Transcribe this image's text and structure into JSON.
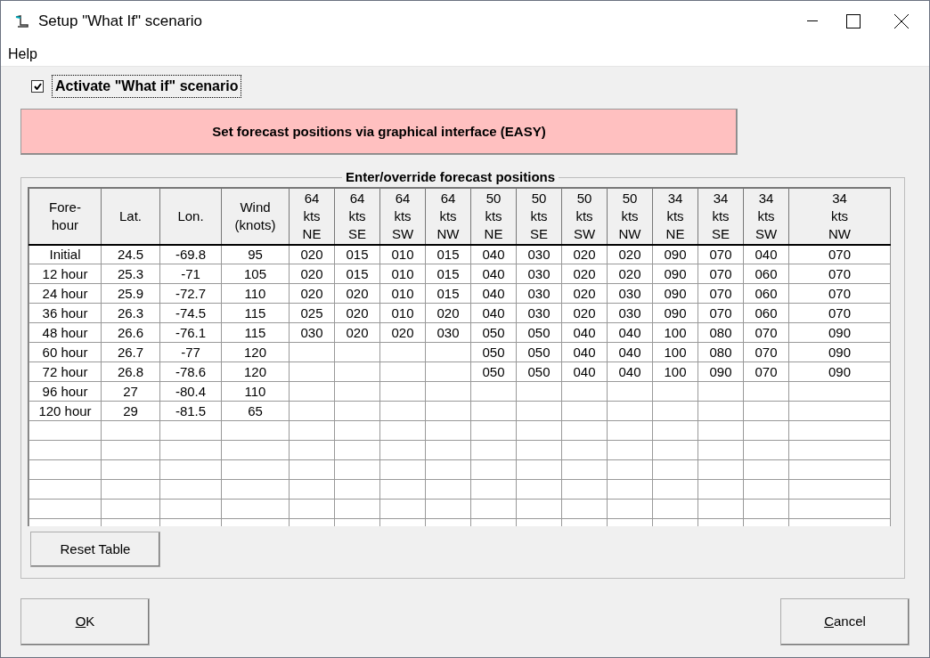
{
  "window": {
    "title": "Setup \"What If\" scenario"
  },
  "menu": [
    "Help"
  ],
  "activate": {
    "label": "Activate \"What if\" scenario",
    "checked": true
  },
  "graphical_button": "Set forecast positions via graphical interface (EASY)",
  "group": {
    "title": "Enter/override forecast positions",
    "columns": [
      "Fore-\nhour",
      "Lat.",
      "Lon.",
      "Wind\n(knots)",
      "64\nkts\nNE",
      "64\nkts\nSE",
      "64\nkts\nSW",
      "64\nkts\nNW",
      "50\nkts\nNE",
      "50\nkts\nSE",
      "50\nkts\nSW",
      "50\nkts\nNW",
      "34\nkts\nNE",
      "34\nkts\nSE",
      "34\nkts\nSW",
      "34\nkts\nNW"
    ],
    "rows": [
      [
        "Initial",
        "24.5",
        "-69.8",
        "95",
        "020",
        "015",
        "010",
        "015",
        "040",
        "030",
        "020",
        "020",
        "090",
        "070",
        "040",
        "070"
      ],
      [
        "12 hour",
        "25.3",
        "-71",
        "105",
        "020",
        "015",
        "010",
        "015",
        "040",
        "030",
        "020",
        "020",
        "090",
        "070",
        "060",
        "070"
      ],
      [
        "24 hour",
        "25.9",
        "-72.7",
        "110",
        "020",
        "020",
        "010",
        "015",
        "040",
        "030",
        "020",
        "030",
        "090",
        "070",
        "060",
        "070"
      ],
      [
        "36 hour",
        "26.3",
        "-74.5",
        "115",
        "025",
        "020",
        "010",
        "020",
        "040",
        "030",
        "020",
        "030",
        "090",
        "070",
        "060",
        "070"
      ],
      [
        "48 hour",
        "26.6",
        "-76.1",
        "115",
        "030",
        "020",
        "020",
        "030",
        "050",
        "050",
        "040",
        "040",
        "100",
        "080",
        "070",
        "090"
      ],
      [
        "60 hour",
        "26.7",
        "-77",
        "120",
        null,
        null,
        null,
        null,
        "050",
        "050",
        "040",
        "040",
        "100",
        "080",
        "070",
        "090"
      ],
      [
        "72 hour",
        "26.8",
        "-78.6",
        "120",
        null,
        null,
        null,
        null,
        "050",
        "050",
        "040",
        "040",
        "100",
        "090",
        "070",
        "090"
      ],
      [
        "96 hour",
        "27",
        "-80.4",
        "110",
        null,
        null,
        null,
        null,
        null,
        null,
        null,
        null,
        null,
        null,
        null,
        null
      ],
      [
        "120 hour",
        "29",
        "-81.5",
        "65",
        null,
        null,
        null,
        null,
        null,
        null,
        null,
        null,
        null,
        null,
        null,
        null
      ]
    ],
    "reset_button": "Reset Table"
  },
  "buttons": [
    {
      "mnemonic": "O",
      "label_rest": "K",
      "kind": "left"
    },
    {
      "mnemonic": "C",
      "label_rest": "ancel",
      "kind": "right"
    }
  ]
}
